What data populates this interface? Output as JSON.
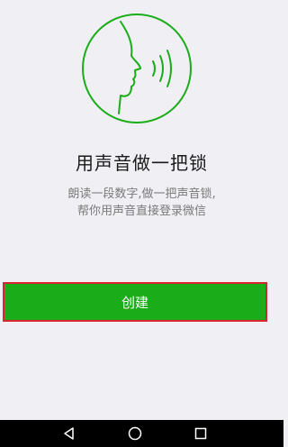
{
  "page": {
    "title": "用声音做一把锁",
    "description_line1": "朗读一段数字,做一把声音锁,",
    "description_line2": "帮你用声音直接登录微信"
  },
  "actions": {
    "create_label": "创建"
  },
  "icons": {
    "illustration": "voice-lock-face-icon",
    "nav_back": "back-triangle-icon",
    "nav_home": "home-circle-icon",
    "nav_recents": "recents-square-icon"
  },
  "colors": {
    "accent_green": "#1aad19",
    "highlight_red": "#d9232e",
    "background": "#efeff4"
  }
}
